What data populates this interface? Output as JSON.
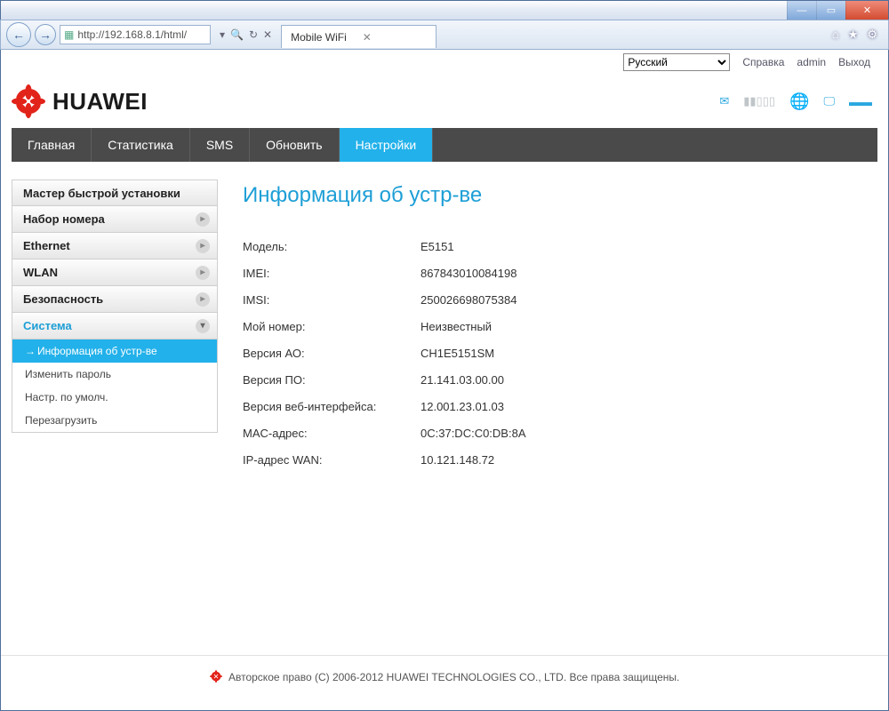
{
  "browser": {
    "url": "http://192.168.8.1/html/",
    "tab_title": "Mobile WiFi"
  },
  "header": {
    "language": "Русский",
    "help": "Справка",
    "user": "admin",
    "logout": "Выход",
    "brand": "HUAWEI"
  },
  "nav": [
    "Главная",
    "Статистика",
    "SMS",
    "Обновить",
    "Настройки"
  ],
  "nav_active": 4,
  "sidebar": {
    "items": [
      {
        "label": "Мастер быстрой установки",
        "chev": false
      },
      {
        "label": "Набор номера",
        "chev": true
      },
      {
        "label": "Ethernet",
        "chev": true
      },
      {
        "label": "WLAN",
        "chev": true
      },
      {
        "label": "Безопасность",
        "chev": true
      },
      {
        "label": "Система",
        "chev": true,
        "open": true
      }
    ],
    "sub": [
      {
        "label": "Информация об устр-ве",
        "active": true
      },
      {
        "label": "Изменить пароль"
      },
      {
        "label": "Настр. по умолч."
      },
      {
        "label": "Перезагрузить"
      }
    ]
  },
  "content": {
    "title": "Информация об устр-ве",
    "rows": [
      {
        "label": "Модель:",
        "value": "E5151"
      },
      {
        "label": "IMEI:",
        "value": "867843010084198"
      },
      {
        "label": "IMSI:",
        "value": "250026698075384"
      },
      {
        "label": "Мой номер:",
        "value": "Неизвестный"
      },
      {
        "label": "Версия АО:",
        "value": "CH1E5151SM"
      },
      {
        "label": "Версия ПО:",
        "value": "21.141.03.00.00"
      },
      {
        "label": "Версия веб-интерфейса:",
        "value": "12.001.23.01.03"
      },
      {
        "label": "MAC-адрес:",
        "value": "0C:37:DC:C0:DB:8A"
      },
      {
        "label": "IP-адрес WAN:",
        "value": "10.121.148.72"
      }
    ]
  },
  "footer": "Авторское право (C) 2006-2012 HUAWEI TECHNOLOGIES CO., LTD. Все права защищены."
}
